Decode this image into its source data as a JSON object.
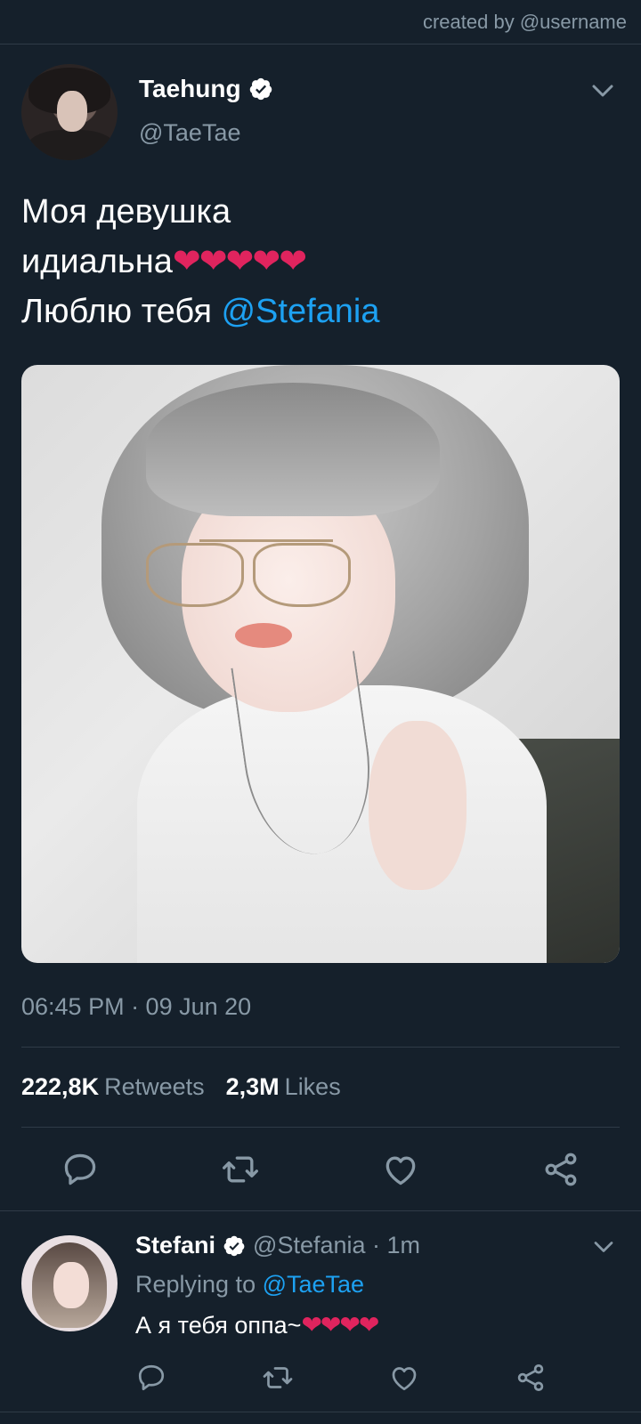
{
  "credit": {
    "text": "created by @username"
  },
  "tweet": {
    "author_name": "Taehung",
    "author_handle": "@TaeTae",
    "text_line1": "Моя девушка",
    "text_line2": "идиальна",
    "text_line2_emoji": "❤❤❤❤❤",
    "text_line3": "Люблю тебя ",
    "text_mention": "@Stefania",
    "timestamp": "06:45 PM · 09 Jun 20",
    "retweets_count": "222,8K",
    "retweets_label": "Retweets",
    "likes_count": "2,3M",
    "likes_label": "Likes"
  },
  "reply": {
    "author_name": "Stefani",
    "author_handle": "@Stefania · 1m",
    "replying_prefix": "Replying to ",
    "replying_handle": "@TaeTae",
    "text": "А я тебя оппа~",
    "text_emoji": "❤❤❤❤"
  },
  "colors": {
    "background": "#15202b",
    "accent": "#1da1f2",
    "secondary_text": "#8899a6",
    "heart": "#e0245e"
  },
  "icons": {
    "verified": "verified-badge-icon",
    "chevron": "chevron-down-icon",
    "reply": "reply-icon",
    "retweet": "retweet-icon",
    "like": "heart-icon",
    "share": "share-icon"
  }
}
